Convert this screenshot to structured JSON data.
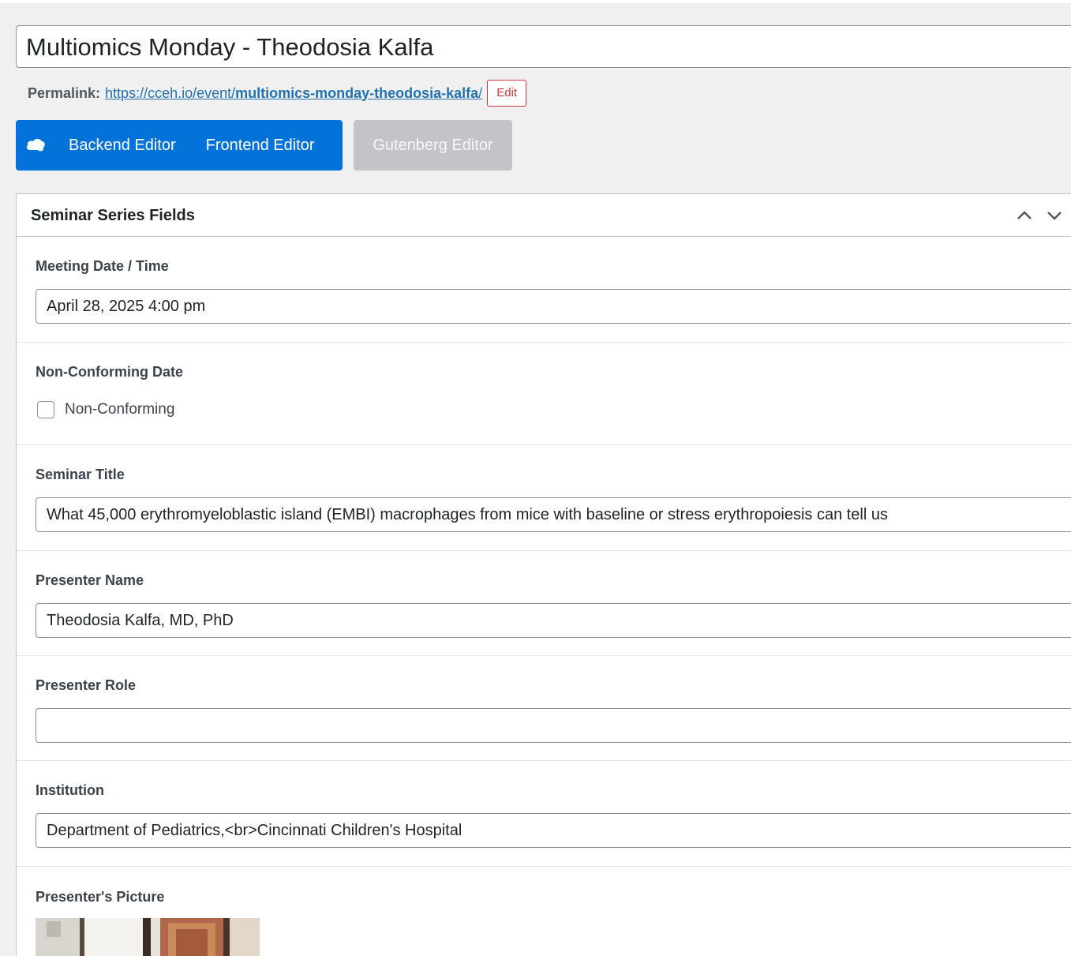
{
  "post": {
    "title": "Multiomics Monday - Theodosia Kalfa"
  },
  "permalink": {
    "label": "Permalink:",
    "url_base": "https://cceh.io/event/",
    "slug": "multiomics-monday-theodosia-kalfa",
    "trailing": "/",
    "edit_label": "Edit"
  },
  "editor_switch": {
    "backend_label": "Backend Editor",
    "frontend_label": "Frontend Editor",
    "gutenberg_label": "Gutenberg Editor"
  },
  "metabox": {
    "title": "Seminar Series Fields",
    "fields": [
      {
        "label": "Meeting Date / Time",
        "value": "April 28, 2025 4:00 pm"
      },
      {
        "label": "Non-Conforming Date",
        "checkbox_label": "Non-Conforming",
        "checked": false
      },
      {
        "label": "Seminar Title",
        "value": "What 45,000 erythromyeloblastic island (EMBI) macrophages from mice with baseline or stress erythropoiesis can tell us"
      },
      {
        "label": "Presenter Name",
        "value": "Theodosia Kalfa, MD, PhD"
      },
      {
        "label": "Presenter Role",
        "value": ""
      },
      {
        "label": "Institution",
        "value": "Department of Pediatrics,<br>Cincinnati Children's Hospital"
      },
      {
        "label": "Presenter's Picture"
      }
    ]
  },
  "colors": {
    "accent": "#0473d9",
    "link": "#2271b1",
    "danger": "#d63638",
    "disabled": "#c3c4c7"
  }
}
